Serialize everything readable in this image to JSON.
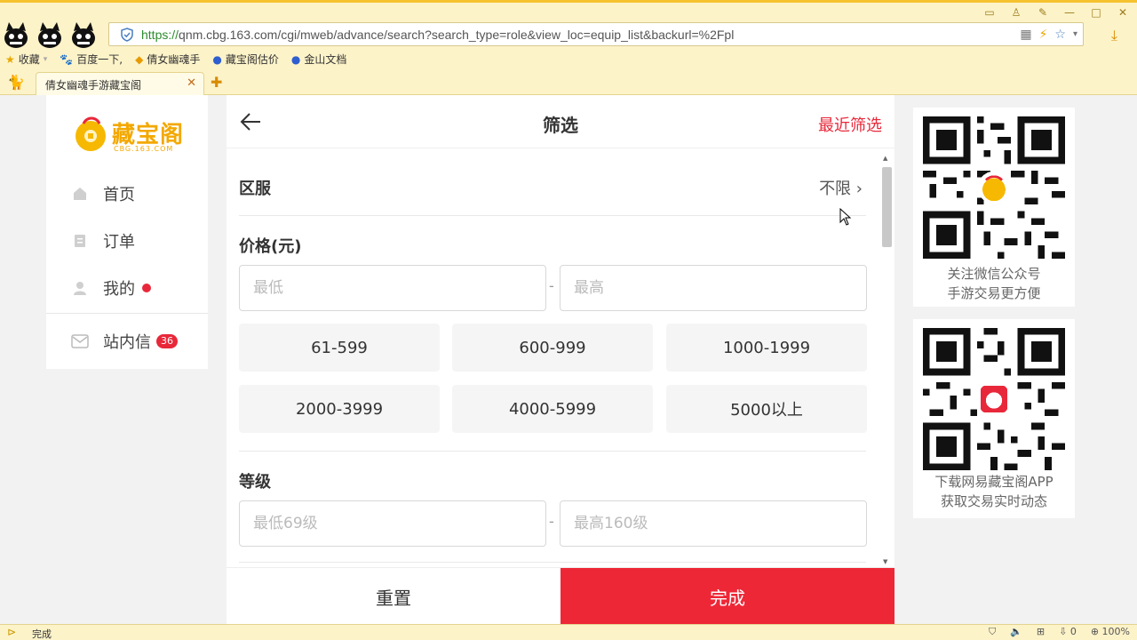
{
  "browser": {
    "url_scheme": "https://",
    "url_rest": "qnm.cbg.163.com/cgi/mweb/advance/search?search_type=role&view_loc=equip_list&backurl=%2Fpl",
    "bookmarks": [
      "收藏",
      "百度一下,",
      "倩女幽魂手",
      "藏宝阁估价",
      "金山文档"
    ],
    "tab_title": "倩女幽魂手游藏宝阁",
    "status_text": "完成",
    "zoom": "100%",
    "download_count": "0"
  },
  "sidebar": {
    "logo_name": "藏宝阁",
    "logo_sub": "CBG.163.COM",
    "items": [
      {
        "label": "首页",
        "icon": "home-icon"
      },
      {
        "label": "订单",
        "icon": "order-icon"
      },
      {
        "label": "我的",
        "icon": "user-icon"
      },
      {
        "label": "站内信",
        "icon": "mail-icon",
        "badge": "36"
      }
    ]
  },
  "filter": {
    "title": "筛选",
    "recent_label": "最近筛选",
    "server_label": "区服",
    "server_value": "不限",
    "price_label": "价格(元)",
    "price_min_placeholder": "最低",
    "price_max_placeholder": "最高",
    "price_chips": [
      "61-599",
      "600-999",
      "1000-1999",
      "2000-3999",
      "4000-5999",
      "5000以上"
    ],
    "level_label": "等级",
    "level_min_placeholder": "最低69级",
    "level_max_placeholder": "最高160级",
    "reset_label": "重置",
    "done_label": "完成"
  },
  "qr_cards": [
    {
      "line1": "关注微信公众号",
      "line2": "手游交易更方便"
    },
    {
      "line1": "下载网易藏宝阁APP",
      "line2": "获取交易实时动态"
    }
  ],
  "colors": {
    "accent": "#ee2737",
    "brand": "#f3a800"
  }
}
